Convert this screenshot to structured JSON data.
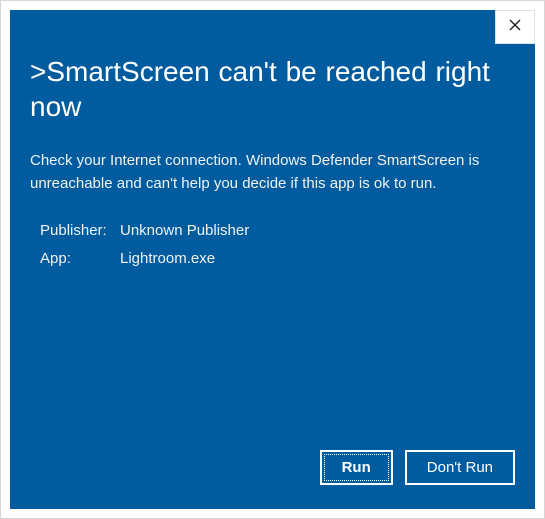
{
  "dialog": {
    "title": ">SmartScreen can't be reached right now",
    "description": "Check your Internet connection. Windows Defender SmartScreen is unreachable and can't help you decide if this app is ok to run.",
    "details": {
      "publisher_label": "Publisher:",
      "publisher_value": "Unknown Publisher",
      "app_label": "App:",
      "app_value": "Lightroom.exe"
    },
    "buttons": {
      "run": "Run",
      "dont_run": "Don't Run"
    }
  }
}
